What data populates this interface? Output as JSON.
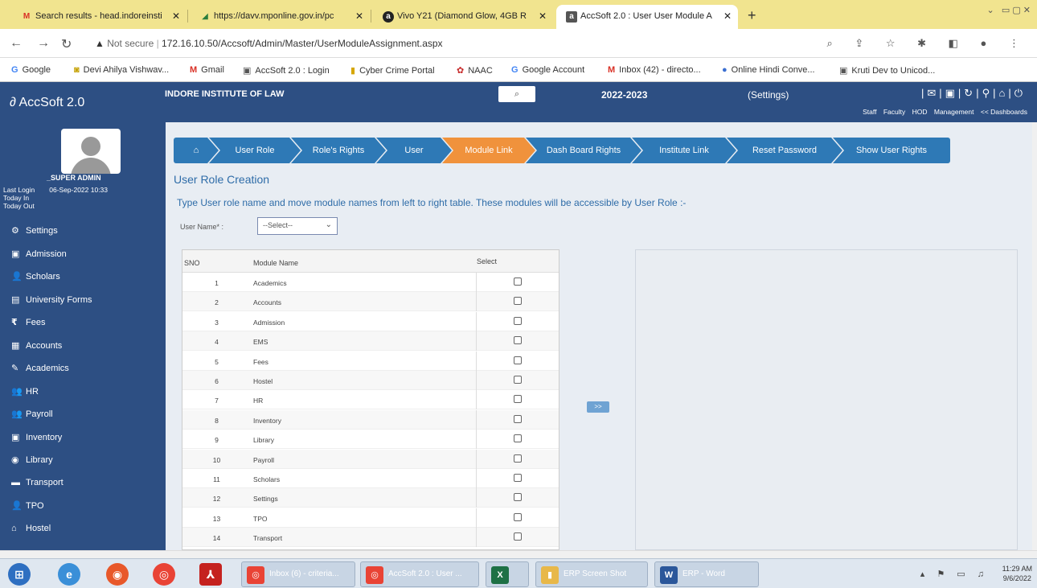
{
  "browser": {
    "tabs": [
      {
        "label": "Search results - head.indoreinsti",
        "icon": "gmail-icon"
      },
      {
        "label": "https://davv.mponline.gov.in/pc",
        "icon": "mponline-icon"
      },
      {
        "label": "Vivo Y21 (Diamond Glow, 4GB R",
        "icon": "amazon-icon"
      },
      {
        "label": "AccSoft 2.0 : User User Module A",
        "icon": "accsoft-icon"
      }
    ],
    "url_prefix": "Not secure",
    "url": "172.16.10.50/Accsoft/Admin/Master/UserModuleAssignment.aspx",
    "bookmarks": [
      {
        "label": "Google",
        "icon": "google-icon"
      },
      {
        "label": "Devi Ahilya Vishwav...",
        "icon": "davv-icon"
      },
      {
        "label": "Gmail",
        "icon": "gmail-icon"
      },
      {
        "label": "AccSoft 2.0 : Login",
        "icon": "accsoft-icon"
      },
      {
        "label": "Cyber Crime Portal",
        "icon": "cyber-icon"
      },
      {
        "label": "NAAC",
        "icon": "naac-icon"
      },
      {
        "label": "Google Account",
        "icon": "google-icon"
      },
      {
        "label": "Inbox (42) - directo...",
        "icon": "gmail-icon"
      },
      {
        "label": "Online Hindi Conve...",
        "icon": "globe-icon"
      },
      {
        "label": "Kruti Dev to Unicod...",
        "icon": "kruti-icon"
      }
    ]
  },
  "header": {
    "brand": "AccSoft 2.0",
    "institute": "INDORE INSTITUTE OF LAW",
    "year": "2022-2023",
    "settings": "(Settings)",
    "links": [
      "Staff",
      "Faculty",
      "HOD",
      "Management",
      "<< Dashboards"
    ]
  },
  "sidebar": {
    "user": "_SUPER ADMIN",
    "last_login_label": "Last Login",
    "last_login_value": "06-Sep-2022 10:33",
    "today_in": "Today In",
    "today_out": "Today Out",
    "items": [
      {
        "label": "Settings",
        "icon": "settings-icon",
        "glyph": "⚙"
      },
      {
        "label": "Admission",
        "icon": "admission-icon",
        "glyph": "▣"
      },
      {
        "label": "Scholars",
        "icon": "scholars-icon",
        "glyph": "👤"
      },
      {
        "label": "University Forms",
        "icon": "forms-icon",
        "glyph": "▤"
      },
      {
        "label": "Fees",
        "icon": "rupee-icon",
        "glyph": "₹"
      },
      {
        "label": "Accounts",
        "icon": "accounts-icon",
        "glyph": "▦"
      },
      {
        "label": "Academics",
        "icon": "pencil-icon",
        "glyph": "✎"
      },
      {
        "label": "HR",
        "icon": "hr-icon",
        "glyph": "👥"
      },
      {
        "label": "Payroll",
        "icon": "payroll-icon",
        "glyph": "👥"
      },
      {
        "label": "Inventory",
        "icon": "inventory-icon",
        "glyph": "▣"
      },
      {
        "label": "Library",
        "icon": "library-icon",
        "glyph": "◉"
      },
      {
        "label": "Transport",
        "icon": "bus-icon",
        "glyph": "▬"
      },
      {
        "label": "TPO",
        "icon": "tpo-icon",
        "glyph": "👤"
      },
      {
        "label": "Hostel",
        "icon": "home-icon",
        "glyph": "⌂"
      }
    ]
  },
  "breadcrumb": [
    {
      "label": "",
      "icon": "home-icon"
    },
    {
      "label": "User Role"
    },
    {
      "label": "Role's Rights"
    },
    {
      "label": "User"
    },
    {
      "label": "Module Link",
      "active": true
    },
    {
      "label": "Dash Board Rights"
    },
    {
      "label": "Institute Link"
    },
    {
      "label": "Reset Password"
    },
    {
      "label": "Show User Rights"
    }
  ],
  "main": {
    "title": "User Role Creation",
    "instruction": "Type User role name and move module names from left to right table. These modules will be accessible by User Role :-",
    "user_label": "User Name* :",
    "user_select": "--Select--",
    "move_button": ">>",
    "table": {
      "headers": [
        "SNO",
        "Module Name",
        "Select"
      ],
      "rows": [
        {
          "sno": "1",
          "name": "Academics"
        },
        {
          "sno": "2",
          "name": "Accounts"
        },
        {
          "sno": "3",
          "name": "Admission"
        },
        {
          "sno": "4",
          "name": "EMS"
        },
        {
          "sno": "5",
          "name": "Fees"
        },
        {
          "sno": "6",
          "name": "Hostel"
        },
        {
          "sno": "7",
          "name": "HR"
        },
        {
          "sno": "8",
          "name": "Inventory"
        },
        {
          "sno": "9",
          "name": "Library"
        },
        {
          "sno": "10",
          "name": "Payroll"
        },
        {
          "sno": "11",
          "name": "Scholars"
        },
        {
          "sno": "12",
          "name": "Settings"
        },
        {
          "sno": "13",
          "name": "TPO"
        },
        {
          "sno": "14",
          "name": "Transport"
        }
      ]
    }
  },
  "taskbar": {
    "apps": [
      {
        "label": "Inbox (6) - criteria...",
        "icon": "chrome-icon"
      },
      {
        "label": "AccSoft 2.0 : User ...",
        "icon": "chrome-icon"
      },
      {
        "label": "",
        "icon": "excel-icon"
      },
      {
        "label": "ERP Screen Shot",
        "icon": "folder-icon"
      },
      {
        "label": "ERP - Word",
        "icon": "word-icon"
      }
    ],
    "time": "11:29 AM",
    "date": "9/6/2022"
  },
  "colors": {
    "primary": "#2d4f83",
    "crumb": "#2e79b6",
    "active": "#f0923c",
    "tabbar": "#f1e48f"
  }
}
